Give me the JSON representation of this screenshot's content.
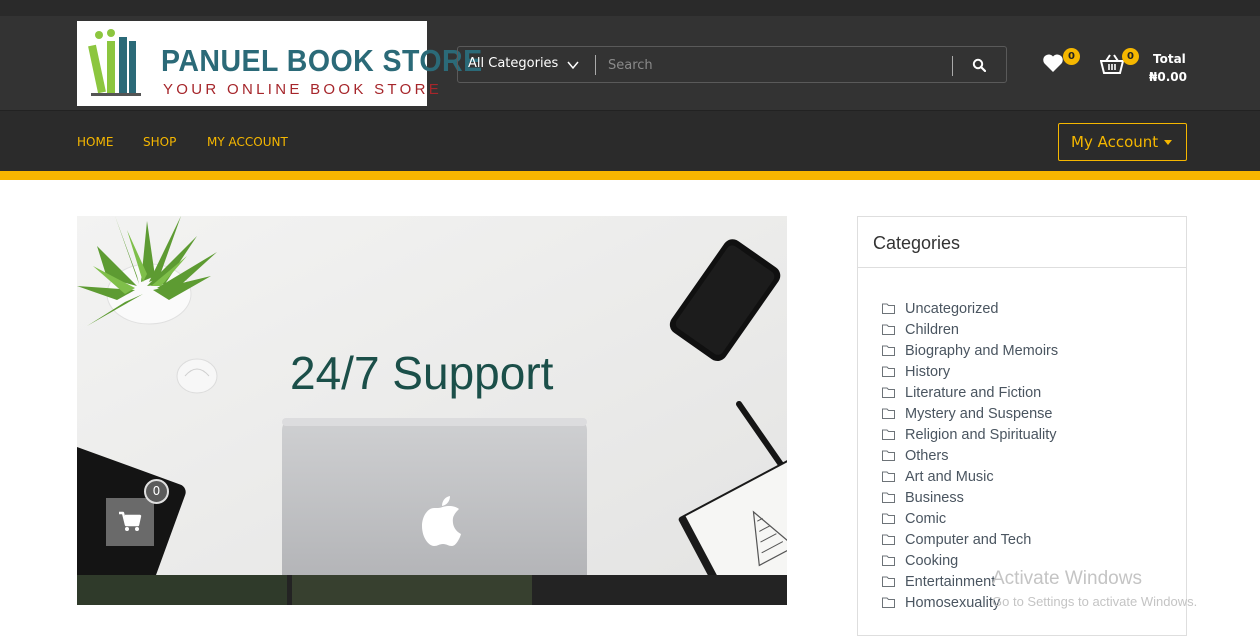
{
  "brand": {
    "name": "PANUEL BOOK STORE",
    "tagline": "YOUR ONLINE BOOK STORE"
  },
  "search": {
    "category_selected": "All Categories",
    "placeholder": "Search",
    "value": "",
    "button_icon": "search-icon"
  },
  "header_icons": {
    "wishlist_icon": "heart-icon",
    "wishlist_count": "0",
    "cart_icon": "basket-icon",
    "cart_count": "0",
    "total_label": "Total",
    "total_value": "₦0.00"
  },
  "nav": {
    "items": [
      {
        "label": "HOME"
      },
      {
        "label": "SHOP"
      },
      {
        "label": "MY ACCOUNT"
      }
    ],
    "account_button": "My Account"
  },
  "hero": {
    "title": "24/7 Support",
    "cart_icon": "shopping-cart-icon",
    "cart_count": "0"
  },
  "sidebar": {
    "title": "Categories",
    "item_icon": "folder-icon",
    "items": [
      "Uncategorized",
      "Children",
      "Biography and Memoirs",
      "History",
      "Literature and Fiction",
      "Mystery and Suspense",
      "Religion and Spirituality",
      "Others",
      "Art and Music",
      "Business",
      "Comic",
      "Computer and Tech",
      "Cooking",
      "Entertainment",
      "Homosexuality"
    ]
  },
  "watermark": {
    "line1": "Activate Windows",
    "line2": "Go to Settings to activate Windows."
  },
  "colors": {
    "header_bg": "#333333",
    "nav_bg": "#2b2b2b",
    "accent": "#f5b700",
    "hero_title": "#1b4f49",
    "brand_teal": "#2b6a78",
    "brand_red": "#a6262b"
  }
}
